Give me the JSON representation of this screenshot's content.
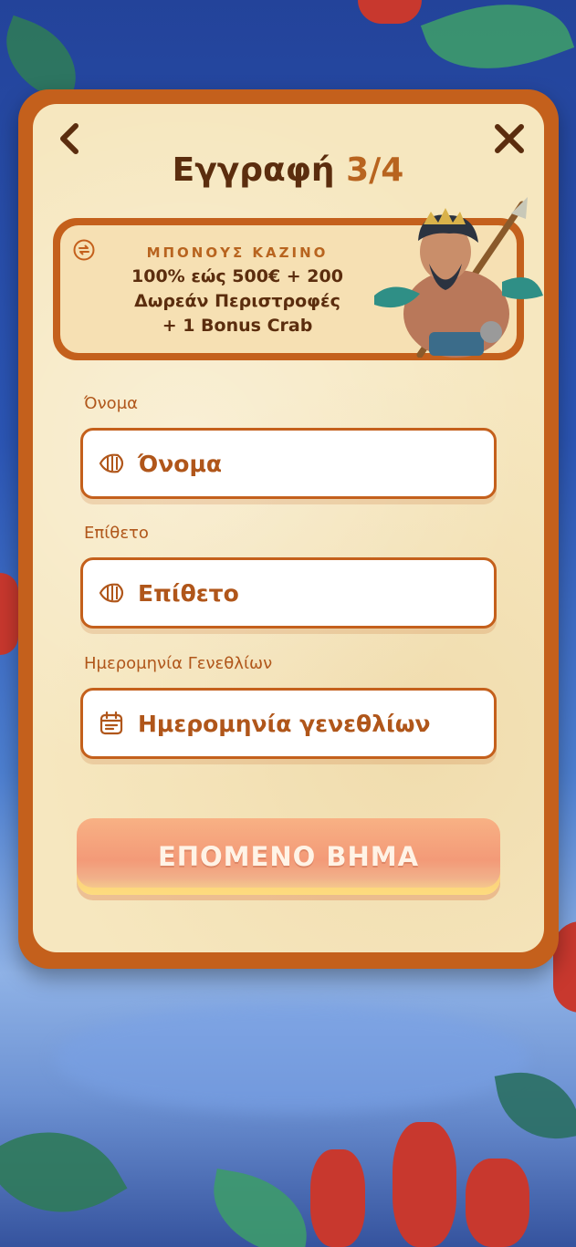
{
  "header": {
    "title": "Εγγραφή",
    "step": "3/4",
    "back_icon": "chevron-left-icon",
    "close_icon": "close-icon"
  },
  "bonus": {
    "tag": "ΜΠΟΝΟΥΣ ΚΑΖΙΝΟ",
    "line1": "100% εώς 500€ + 200",
    "line2": "Δωρεάν Περιστροφές",
    "line3": "+ 1 Bonus Crab",
    "icon": "swap-icon"
  },
  "form": {
    "first_name": {
      "label": "Όνομα",
      "placeholder": "Όνομα",
      "icon": "fish-icon"
    },
    "last_name": {
      "label": "Επίθετο",
      "placeholder": "Επίθετο",
      "icon": "fish-icon"
    },
    "birthdate": {
      "label": "Ημερομηνία Γενεθλίων",
      "placeholder": "Ημερομηνία γενεθλίων",
      "icon": "calendar-icon"
    }
  },
  "next_button": {
    "label": "ΕΠΟΜΕΝΟ ΒΗΜΑ"
  },
  "colors": {
    "frame": "#c4601c",
    "parchment": "#f6e7bf",
    "title_dark": "#5b2d0e",
    "accent": "#b8641f",
    "button": "#f39a78"
  }
}
